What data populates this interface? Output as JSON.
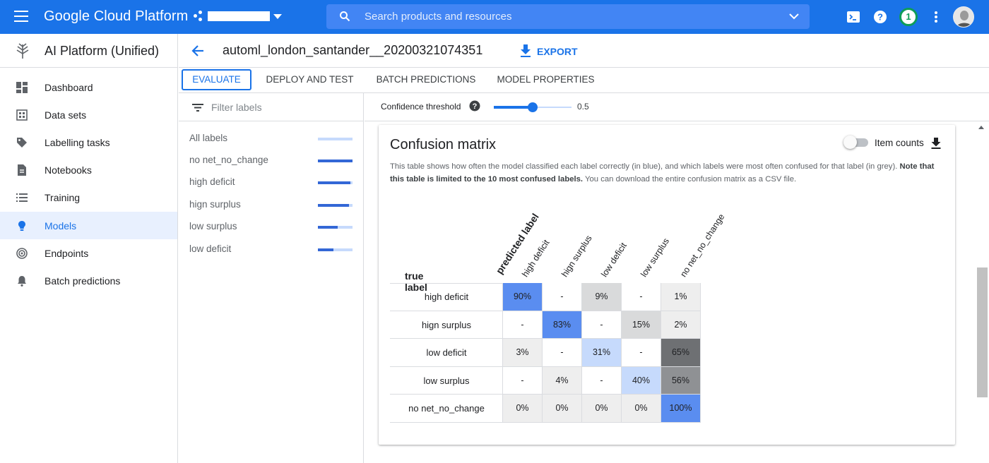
{
  "topbar": {
    "brand": "Google Cloud Platform",
    "search_placeholder": "Search products and resources",
    "notification_count": "1"
  },
  "sidebar": {
    "title": "AI Platform (Unified)",
    "items": [
      {
        "label": "Dashboard",
        "icon": "dashboard-icon"
      },
      {
        "label": "Data sets",
        "icon": "dataset-icon"
      },
      {
        "label": "Labelling tasks",
        "icon": "tag-icon"
      },
      {
        "label": "Notebooks",
        "icon": "notebook-icon"
      },
      {
        "label": "Training",
        "icon": "list-icon"
      },
      {
        "label": "Models",
        "icon": "bulb-icon",
        "active": true
      },
      {
        "label": "Endpoints",
        "icon": "endpoint-icon"
      },
      {
        "label": "Batch predictions",
        "icon": "bell-icon"
      }
    ]
  },
  "header": {
    "model_name": "automl_london_santander__20200321074351",
    "export_label": "EXPORT"
  },
  "tabs": [
    {
      "label": "EVALUATE",
      "active": true
    },
    {
      "label": "DEPLOY AND TEST"
    },
    {
      "label": "BATCH PREDICTIONS"
    },
    {
      "label": "MODEL PROPERTIES"
    }
  ],
  "filter": {
    "placeholder": "Filter labels",
    "labels": [
      {
        "name": "All labels",
        "score": 0.0
      },
      {
        "name": "no net_no_change",
        "score": 1.0
      },
      {
        "name": "high deficit",
        "score": 0.94
      },
      {
        "name": "hign surplus",
        "score": 0.9
      },
      {
        "name": "low surplus",
        "score": 0.58
      },
      {
        "name": "low deficit",
        "score": 0.45
      }
    ]
  },
  "threshold": {
    "label": "Confidence threshold",
    "value": 0.5,
    "value_text": "0.5"
  },
  "card": {
    "title": "Confusion matrix",
    "item_counts_label": "Item counts",
    "item_counts_on": false,
    "desc_plain_1": "This table shows how often the model classified each label correctly (in blue), and which labels were most often confused for that label (in grey). ",
    "desc_bold": "Note that this table is limited to the 10 most confused labels.",
    "desc_plain_2": " You can download the entire confusion matrix as a CSV file."
  },
  "matrix": {
    "true_label_title": "true label",
    "predicted_label_title": "predicted label",
    "columns": [
      "high deficit",
      "hign surplus",
      "low deficit",
      "low surplus",
      "no net_no_change"
    ],
    "rows": [
      {
        "label": "high deficit",
        "cells": [
          "90%",
          "-",
          "9%",
          "-",
          "1%"
        ]
      },
      {
        "label": "hign surplus",
        "cells": [
          "-",
          "83%",
          "-",
          "15%",
          "2%"
        ]
      },
      {
        "label": "low deficit",
        "cells": [
          "3%",
          "-",
          "31%",
          "-",
          "65%"
        ]
      },
      {
        "label": "low surplus",
        "cells": [
          "-",
          "4%",
          "-",
          "40%",
          "56%"
        ]
      },
      {
        "label": "no net_no_change",
        "cells": [
          "0%",
          "0%",
          "0%",
          "0%",
          "100%"
        ]
      }
    ],
    "diagonal_cells": [
      [
        0,
        0
      ],
      [
        1,
        1
      ],
      [
        2,
        2
      ],
      [
        3,
        3
      ],
      [
        4,
        4
      ]
    ],
    "colors": {
      "correct_strong": "#5a8df0",
      "correct_light": "#c6dafc",
      "confused_dark": "#6e7073",
      "confused_mid": "#8f9194",
      "confused_light": "#d9dadb",
      "confused_faint": "#eeeeee",
      "empty": "#ffffff"
    }
  },
  "colors": {
    "brand_blue": "#1a73e8",
    "search_bg": "#4285f4",
    "active_bg": "#e8f0fe"
  }
}
